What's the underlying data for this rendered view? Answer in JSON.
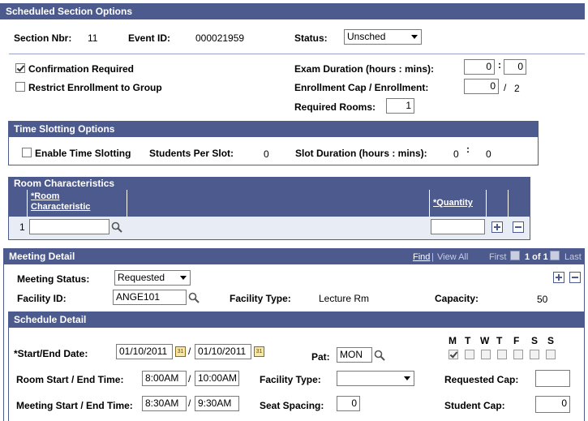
{
  "header": {
    "title": "Scheduled Section Options"
  },
  "section": {
    "nbr_label": "Section Nbr:",
    "nbr_value": "11",
    "event_label": "Event ID:",
    "event_value": "000021959",
    "status_label": "Status:",
    "status_value": "Unsched"
  },
  "options": {
    "confirmation_label": "Confirmation Required",
    "confirmation_checked": true,
    "restrict_label": "Restrict Enrollment to Group",
    "restrict_checked": false,
    "exam_label": "Exam Duration (hours : mins):",
    "exam_hours": "0",
    "exam_sep": ":",
    "exam_mins": "0",
    "cap_label": "Enrollment Cap / Enrollment:",
    "cap_value": "0",
    "cap_sep": "/",
    "enrollment_value": "2",
    "rooms_label": "Required Rooms:",
    "rooms_value": "1"
  },
  "time_slotting": {
    "title": "Time Slotting Options",
    "enable_label": "Enable Time Slotting",
    "students_label": "Students Per Slot:",
    "students_value": "0",
    "duration_label": "Slot Duration (hours : mins):",
    "duration_hours": "0",
    "duration_sep": ":",
    "duration_mins": "0"
  },
  "room_characteristics": {
    "title": "Room Characteristics",
    "col_characteristic": "*Room Characteristic",
    "col_characteristic_l1": "*Room",
    "col_characteristic_l2": "Characteristic",
    "col_quantity": "*Quantity",
    "row_number": "1"
  },
  "meeting_detail": {
    "title": "Meeting Detail",
    "find": "Find",
    "view_all": "View All",
    "sep": "|",
    "first": "First",
    "page": "1 of 1",
    "last": "Last",
    "status_label": "Meeting Status:",
    "status_value": "Requested",
    "facility_label": "Facility ID:",
    "facility_value": "ANGE101",
    "facility_type_label": "Facility Type:",
    "facility_type_value": "Lecture Rm",
    "capacity_label": "Capacity:",
    "capacity_value": "50"
  },
  "schedule_detail": {
    "title": "Schedule Detail",
    "date_label": "*Start/End Date:",
    "start_date": "01/10/2011",
    "date_sep": "/",
    "end_date": "01/10/2011",
    "pat_label": "Pat:",
    "pat_value": "MON",
    "days": [
      "M",
      "T",
      "W",
      "T",
      "F",
      "S",
      "S"
    ],
    "days_checked": [
      true,
      false,
      false,
      false,
      false,
      false,
      false
    ],
    "room_time_label": "Room Start / End Time:",
    "room_start": "8:00AM",
    "room_sep": "/",
    "room_end": "10:00AM",
    "facility_type_label": "Facility Type:",
    "facility_type_value": "",
    "requested_cap_label": "Requested Cap:",
    "requested_cap_value": "",
    "meeting_time_label": "Meeting Start / End Time:",
    "meeting_start": "8:30AM",
    "meeting_sep": "/",
    "meeting_end": "9:30AM",
    "seat_spacing_label": "Seat Spacing:",
    "seat_spacing_value": "0",
    "student_cap_label": "Student Cap:",
    "student_cap_value": "0"
  },
  "colors": {
    "header_bg": "#4d5a8e",
    "grid_row_bg": "#e8ecf5"
  }
}
